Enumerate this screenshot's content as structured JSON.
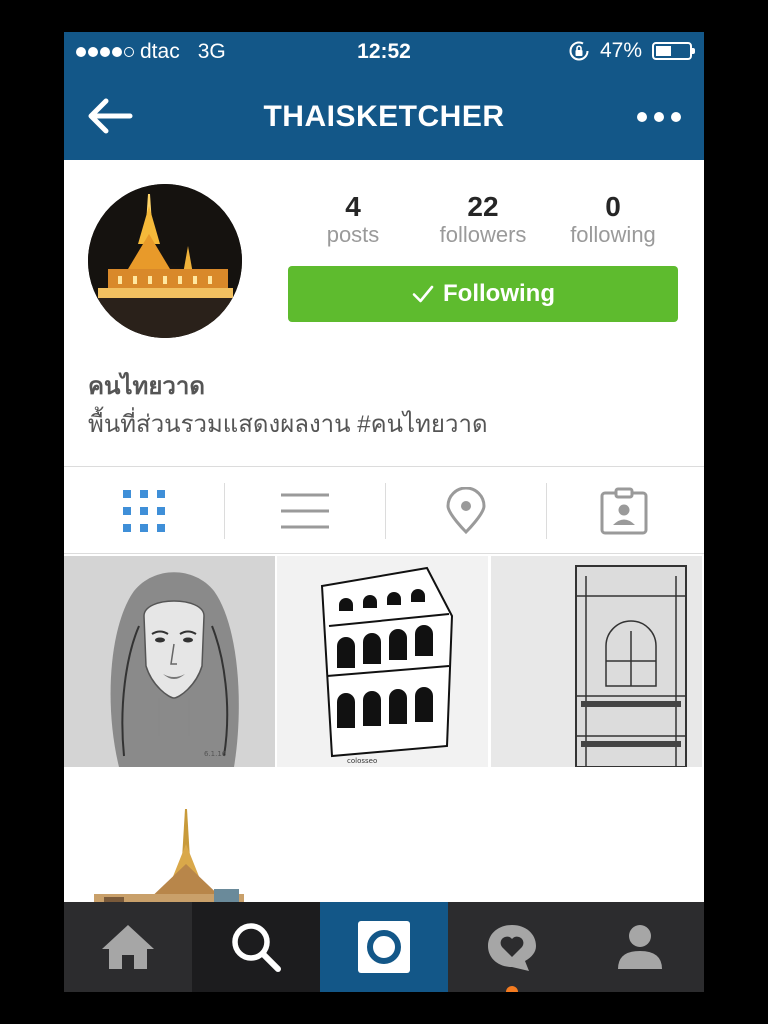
{
  "status_bar": {
    "carrier": "dtac",
    "network": "3G",
    "time": "12:52",
    "battery_percent": "47%",
    "battery_level": 0.47
  },
  "nav": {
    "title": "THAISKETCHER",
    "back_icon": "arrow-left-icon",
    "more_icon": "ellipsis-icon"
  },
  "profile": {
    "stats": [
      {
        "value": "4",
        "label": "posts"
      },
      {
        "value": "22",
        "label": "followers"
      },
      {
        "value": "0",
        "label": "following"
      }
    ],
    "following_button": "Following",
    "name": "คนไทยวาด",
    "bio": "พื้นที่ส่วนรวมแสดงผลงาน #คนไทยวาด"
  },
  "view_tabs": [
    {
      "icon": "grid-view-icon",
      "active": true
    },
    {
      "icon": "list-view-icon",
      "active": false
    },
    {
      "icon": "location-pin-icon",
      "active": false
    },
    {
      "icon": "tagged-photos-icon",
      "active": false
    }
  ],
  "posts": [
    {
      "icon": "portrait-sketch-thumbnail"
    },
    {
      "icon": "colosseum-sketch-thumbnail"
    },
    {
      "icon": "building-facade-sketch-thumbnail"
    },
    {
      "icon": "thai-temple-sketch-thumbnail"
    }
  ],
  "tab_bar": [
    {
      "icon": "home-icon"
    },
    {
      "icon": "search-icon",
      "active": true
    },
    {
      "icon": "camera-icon"
    },
    {
      "icon": "activity-heart-icon",
      "has_notification": true
    },
    {
      "icon": "profile-icon"
    }
  ],
  "colors": {
    "brand_blue": "#135788",
    "follow_green": "#5ebb2e",
    "grid_active": "#3f8fd8",
    "notification": "#f47b20"
  }
}
